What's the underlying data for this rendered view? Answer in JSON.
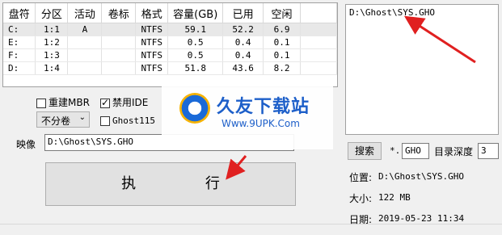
{
  "table": {
    "columns": [
      "盘符",
      "分区",
      "活动",
      "卷标",
      "格式",
      "容量(GB)",
      "已用",
      "空闲"
    ],
    "rows": [
      [
        "C:",
        "1:1",
        "A",
        "",
        "NTFS",
        "59.1",
        "52.2",
        "6.9"
      ],
      [
        "E:",
        "1:2",
        "",
        "",
        "NTFS",
        "0.5",
        "0.4",
        "0.1"
      ],
      [
        "F:",
        "1:3",
        "",
        "",
        "NTFS",
        "0.5",
        "0.4",
        "0.1"
      ],
      [
        "D:",
        "1:4",
        "",
        "",
        "NTFS",
        "51.8",
        "43.6",
        "8.2"
      ]
    ]
  },
  "options": {
    "rebuild_mbr": "重建MBR",
    "disable_ide": "禁用IDE",
    "split_select": "不分卷",
    "ghost115": "Ghost115",
    "rebuild_mbr_checked": false,
    "disable_ide_checked": true,
    "ghost115_checked": false
  },
  "image": {
    "label": "映像",
    "path": "D:\\Ghost\\SYS.GHO"
  },
  "run_button": "执 行",
  "file_list": [
    "D:\\Ghost\\SYS.GHO"
  ],
  "search": {
    "button": "搜索",
    "prefix": "*.",
    "ext": "GHO",
    "depth_label": "目录深度",
    "depth": "3"
  },
  "info": {
    "location_label": "位置:",
    "location": "D:\\Ghost\\SYS.GHO",
    "size_label": "大小:",
    "size": "122 MB",
    "date_label": "日期:",
    "date": "2019-05-23",
    "time": "11:34"
  },
  "watermark": {
    "title": "久友下载站",
    "url": "Www.9UPK.Com"
  },
  "colors": {
    "arrow": "#e02020",
    "watermark_blue": "#1d5fc9"
  }
}
